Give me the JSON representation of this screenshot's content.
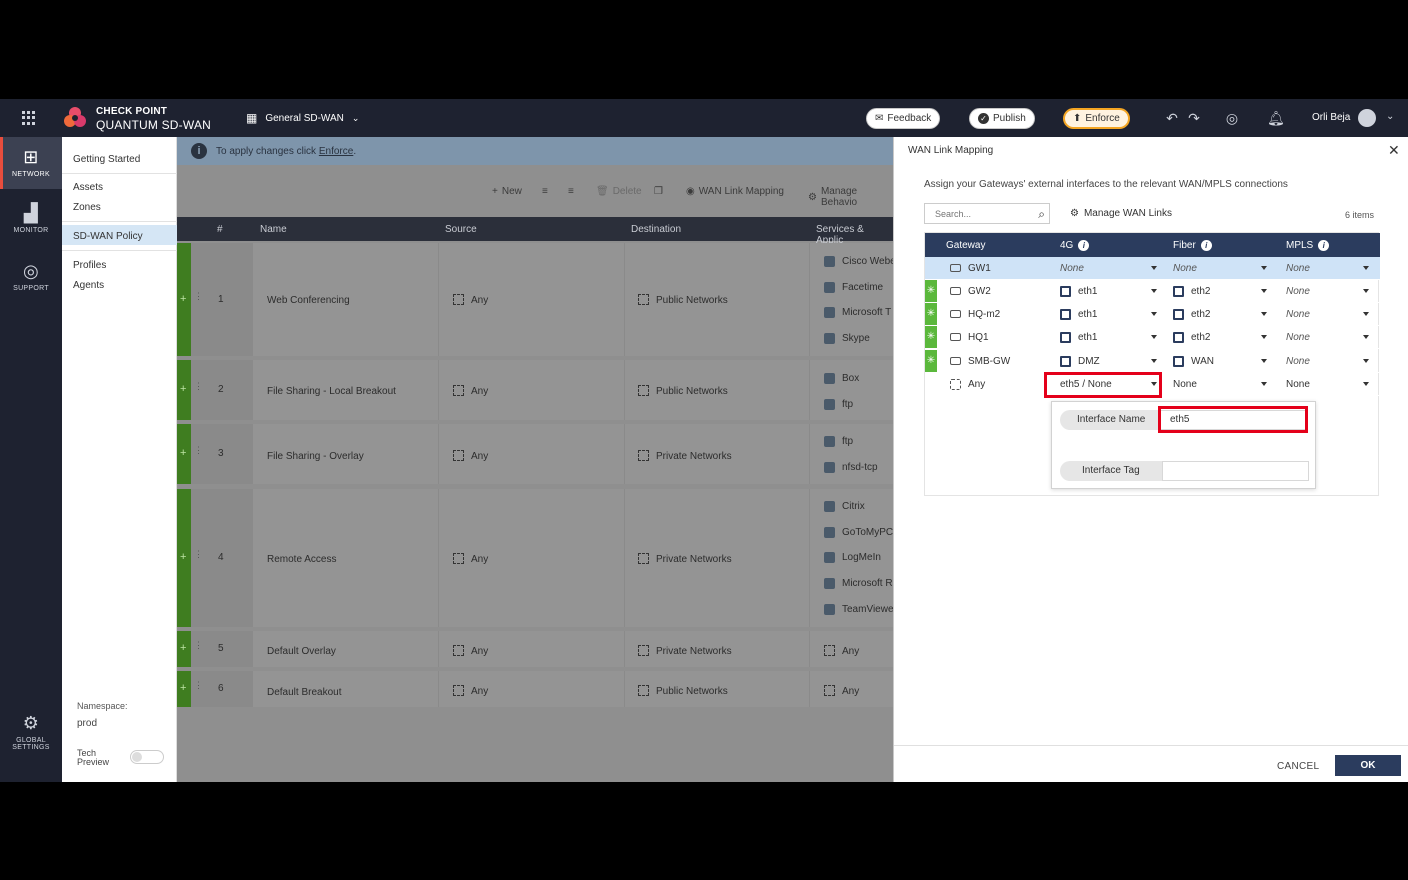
{
  "header": {
    "brand_line1": "CHECK POINT",
    "brand_line2": "QUANTUM SD-WAN",
    "policy_selector": "General SD-WAN",
    "feedback_label": "Feedback",
    "publish_label": "Publish",
    "enforce_label": "Enforce",
    "user_name": "Orli Beja"
  },
  "leftnav": {
    "network": "NETWORK",
    "monitor": "MONITOR",
    "support": "SUPPORT",
    "global_settings_1": "GLOBAL",
    "global_settings_2": "SETTINGS"
  },
  "subnav": {
    "getting_started": "Getting Started",
    "assets": "Assets",
    "zones": "Zones",
    "sdwan_policy": "SD-WAN Policy",
    "profiles": "Profiles",
    "agents": "Agents",
    "namespace_label": "Namespace:",
    "namespace_value": "prod",
    "tech_preview_1": "Tech",
    "tech_preview_2": "Preview"
  },
  "main": {
    "info_text": "To apply changes click",
    "info_link": "Enforce",
    "toolbar": {
      "new": "New",
      "delete": "Delete",
      "wan_link_mapping": "WAN Link Mapping",
      "manage_behavior": "Manage Behavio"
    },
    "columns": {
      "num": "#",
      "name": "Name",
      "source": "Source",
      "destination": "Destination",
      "services": "Services & Applic"
    },
    "rows": [
      {
        "num": "1",
        "name": "Web Conferencing",
        "source": "Any",
        "destination": "Public Networks",
        "services": [
          "Cisco Webe",
          "Facetime",
          "Microsoft T",
          "Skype"
        ]
      },
      {
        "num": "2",
        "name": "File Sharing - Local Breakout",
        "source": "Any",
        "destination": "Public Networks",
        "services": [
          "Box",
          "ftp"
        ]
      },
      {
        "num": "3",
        "name": "File Sharing - Overlay",
        "source": "Any",
        "destination": "Private Networks",
        "services": [
          "ftp",
          "nfsd-tcp"
        ]
      },
      {
        "num": "4",
        "name": "Remote Access",
        "source": "Any",
        "destination": "Private Networks",
        "services": [
          "Citrix",
          "GoToMyPC",
          "LogMeIn",
          "Microsoft R",
          "TeamViewe"
        ]
      },
      {
        "num": "5",
        "name": "Default Overlay",
        "source": "Any",
        "destination": "Private Networks",
        "services": [
          "Any"
        ]
      },
      {
        "num": "6",
        "name": "Default Breakout",
        "source": "Any",
        "destination": "Public Networks",
        "services": [
          "Any"
        ]
      }
    ]
  },
  "panel": {
    "title": "WAN Link Mapping",
    "description": "Assign your Gateways' external interfaces to the relevant WAN/MPLS connections",
    "search_placeholder": "Search...",
    "manage_wan_links": "Manage WAN Links",
    "item_count": "6 items",
    "columns": {
      "gateway": "Gateway",
      "c4g": "4G",
      "fiber": "Fiber",
      "mpls": "MPLS"
    },
    "rows": [
      {
        "gateway": "GW1",
        "g4": "None",
        "fiber": "None",
        "mpls": "None"
      },
      {
        "gateway": "GW2",
        "g4": "eth1",
        "fiber": "eth2",
        "mpls": "None"
      },
      {
        "gateway": "HQ-m2",
        "g4": "eth1",
        "fiber": "eth2",
        "mpls": "None"
      },
      {
        "gateway": "HQ1",
        "g4": "eth1",
        "fiber": "eth2",
        "mpls": "None"
      },
      {
        "gateway": "SMB-GW",
        "g4": "DMZ",
        "fiber": "WAN",
        "mpls": "None"
      },
      {
        "gateway": "Any",
        "g4": "eth5 / None",
        "fiber": "None",
        "mpls": "None"
      }
    ],
    "popup": {
      "interface_name_label": "Interface Name",
      "interface_name_value": "eth5",
      "interface_tag_label": "Interface Tag",
      "interface_tag_value": ""
    },
    "cancel_label": "CANCEL",
    "ok_label": "OK"
  },
  "colors": {
    "topbar": "#1e2230",
    "panel_header": "#2b3c5e",
    "rule_bar": "#3f7d20",
    "gw_bar": "#5bb83c",
    "highlight": "#e4001a",
    "enforce": "#f5a623"
  }
}
